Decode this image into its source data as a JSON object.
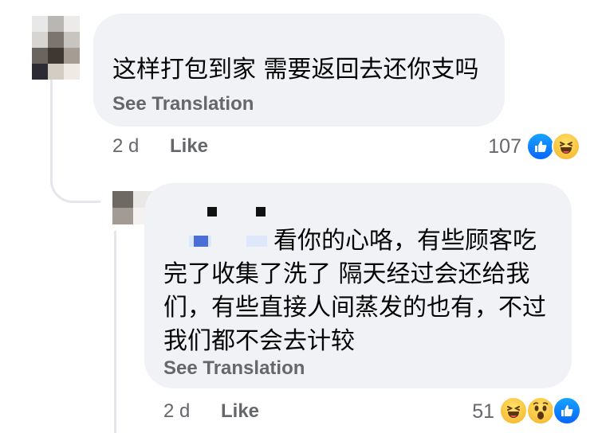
{
  "comment1": {
    "text": "这样打包到家 需要返回去还你支吗",
    "see_translation": "See Translation",
    "age": "2 d",
    "like_label": "Like",
    "reaction_count": "107",
    "reactions": [
      "like-icon",
      "haha-icon"
    ]
  },
  "reply1": {
    "text": "看你的心咯，有些顾客吃完了收集了洗了 隔天经过会还给我们，有些直接人间蒸发的也有，不过我们都不会去计较",
    "see_translation": "See Translation",
    "age": "2 d",
    "like_label": "Like",
    "reaction_count": "51",
    "reactions": [
      "haha-icon",
      "wow-icon",
      "like-icon"
    ]
  },
  "colors": {
    "bubble": "#f0f2f5",
    "meta_text": "#65676b",
    "like_blue": "#0866ff",
    "emoji_yellow": "#f7b125"
  }
}
